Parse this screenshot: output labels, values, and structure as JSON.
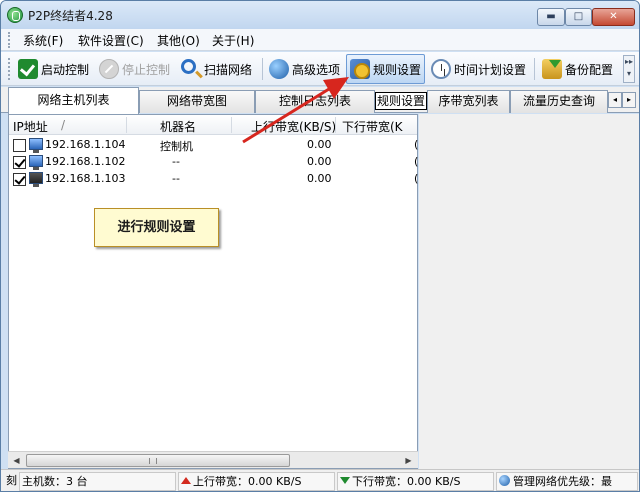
{
  "window": {
    "title": "P2P终结者4.28",
    "minimize_glyph": "▬",
    "maximize_glyph": "□",
    "close_glyph": "✕"
  },
  "menu": {
    "items": [
      {
        "label": "系统(F)"
      },
      {
        "label": "软件设置(C)"
      },
      {
        "label": "其他(O)"
      },
      {
        "label": "关于(H)"
      }
    ]
  },
  "toolbar": {
    "start": "启动控制",
    "stop": "停止控制",
    "scan": "扫描网络",
    "advanced": "高级选项",
    "rules": "规则设置",
    "schedule": "时间计划设置",
    "backup": "备份配置",
    "more_glyph": "▸▸ ▾"
  },
  "tabs": [
    {
      "label": "网络主机列表"
    },
    {
      "label": "网络带宽图"
    },
    {
      "label": "控制日志列表"
    },
    {
      "label": "规则设置"
    },
    {
      "label": "序带宽列表"
    },
    {
      "label": "流量历史查询"
    }
  ],
  "tab_scroll": {
    "left": "◂",
    "right": "▸"
  },
  "list": {
    "headers": {
      "ip": "IP地址",
      "sort_glyph": "/",
      "name": "机器名",
      "up": "上行带宽(KB/S)",
      "down": "下行带宽(K"
    },
    "rows": [
      {
        "checked": false,
        "ip": "192.168.1.104",
        "name": "控制机",
        "up": "0.00",
        "down": "("
      },
      {
        "checked": true,
        "ip": "192.168.1.102",
        "name": "--",
        "up": "0.00",
        "down": "("
      },
      {
        "checked": true,
        "ip": "192.168.1.103",
        "name": "--",
        "up": "0.00",
        "down": "("
      }
    ]
  },
  "scrollbar": {
    "left_glyph": "◀",
    "right_glyph": "▶"
  },
  "callout": {
    "text": "进行规则设置"
  },
  "status": {
    "prefix": "刻",
    "hosts": "主机数：3 台",
    "upload": "上行带宽：0.00 KB/S",
    "download": "下行带宽：0.00 KB/S",
    "priority": "管理网络优先级：最"
  },
  "colors": {
    "arrow": "#d7261e",
    "callout_bg": "#fffbd1",
    "callout_border": "#b98f26"
  }
}
